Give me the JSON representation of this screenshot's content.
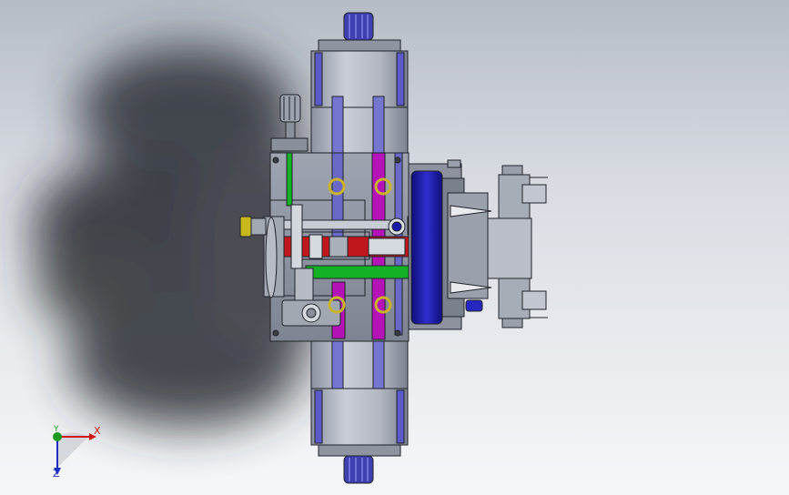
{
  "viewport": {
    "background_top": "#b6bcc6",
    "background_bottom": "#f6f7f9"
  },
  "model": {
    "fluid_colors": {
      "pressure": "#c0171c",
      "return": "#14b025",
      "pilot": "#b512b8",
      "drain": "#6a69c7"
    },
    "solenoid_color": "#1a1aa8",
    "body_color": "#a9aeb8",
    "edge_color": "#20222a"
  },
  "triad": {
    "x_label": "X",
    "y_label": "Y",
    "z_label": "Z",
    "x_color": "#d01818",
    "y_color": "#1a9a1a",
    "z_color": "#1c2fc0"
  }
}
